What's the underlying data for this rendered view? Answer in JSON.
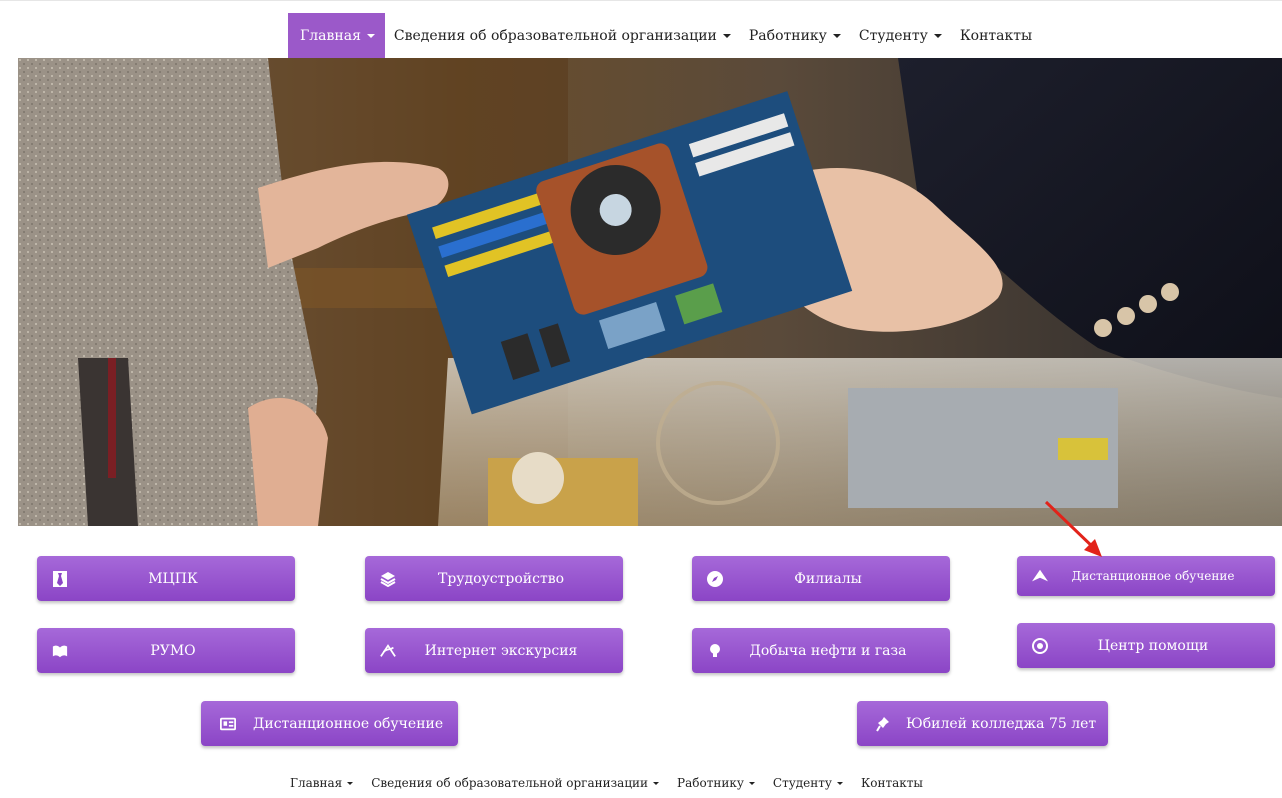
{
  "nav": {
    "items": [
      {
        "label": "Главная",
        "dropdown": true,
        "active": true
      },
      {
        "label": "Сведения об образовательной организации",
        "dropdown": true
      },
      {
        "label": "Работнику",
        "dropdown": true
      },
      {
        "label": "Студенту",
        "dropdown": true
      },
      {
        "label": "Контакты",
        "dropdown": false
      }
    ],
    "active_color": "#9b59c9"
  },
  "hero": {
    "alt": "Two people hand over a motherboard above a transparent PC case"
  },
  "buttons": {
    "mcpk": "МЦПК",
    "employment": "Трудоустройство",
    "branches": "Филиалы",
    "distance_top": "Дистанционное обучение",
    "rumo": "РУМО",
    "excursion": "Интернет экскурсия",
    "oil": "Добыча нефти и газа",
    "help": "Центр помощи",
    "distance_bottom": "Дистанционное обучение",
    "jubilee": "Юбилей колледжа 75 лет"
  },
  "button_color": "#9b59c9",
  "footer_nav": {
    "items": [
      {
        "label": "Главная",
        "dropdown": true
      },
      {
        "label": "Сведения об образовательной организации",
        "dropdown": true
      },
      {
        "label": "Работнику",
        "dropdown": true
      },
      {
        "label": "Студенту",
        "dropdown": true
      },
      {
        "label": "Контакты",
        "dropdown": false
      }
    ]
  }
}
